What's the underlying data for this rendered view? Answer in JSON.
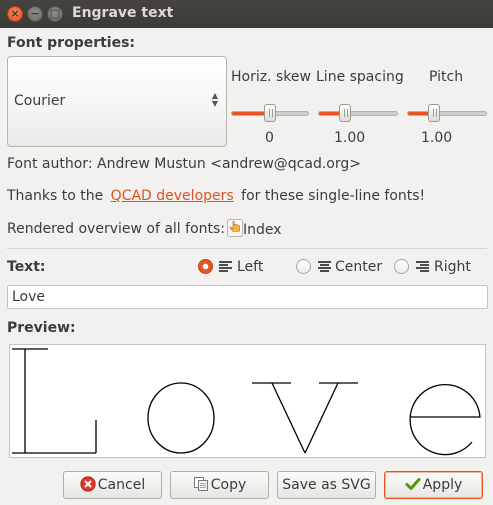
{
  "window": {
    "title": "Engrave text",
    "close_glyph": "×",
    "min_glyph": "−",
    "max_glyph": "□"
  },
  "font_properties": {
    "heading": "Font properties:",
    "selected_font": "Courier",
    "select_arrows": "▲▼"
  },
  "sliders": [
    {
      "label": "Horiz. skew",
      "value": "0",
      "fraction": 0.5
    },
    {
      "label": "Line spacing",
      "value": "1.00",
      "fraction": 0.333
    },
    {
      "label": "Pitch",
      "value": "1.00",
      "fraction": 0.333
    }
  ],
  "info": {
    "author": "Font author: Andrew Mustun <andrew@qcad.org>",
    "thanks_prefix": "Thanks to the",
    "thanks_link": "QCAD developers",
    "thanks_suffix": "for these single-line fonts!",
    "overview_label": "Rendered overview of all fonts:",
    "index_label": "Index"
  },
  "text_section": {
    "heading": "Text:",
    "alignment": [
      {
        "label": "Left",
        "checked": true
      },
      {
        "label": "Center",
        "checked": false
      },
      {
        "label": "Right",
        "checked": false
      }
    ],
    "value": "Love"
  },
  "preview": {
    "heading": "Preview:"
  },
  "buttons": {
    "cancel": "Cancel",
    "copy": "Copy",
    "save_svg": "Save as SVG",
    "apply": "Apply"
  },
  "colors": {
    "accent": "#e95420",
    "titlebar": "#3c3b37",
    "window_bg": "#f2f1f0"
  }
}
